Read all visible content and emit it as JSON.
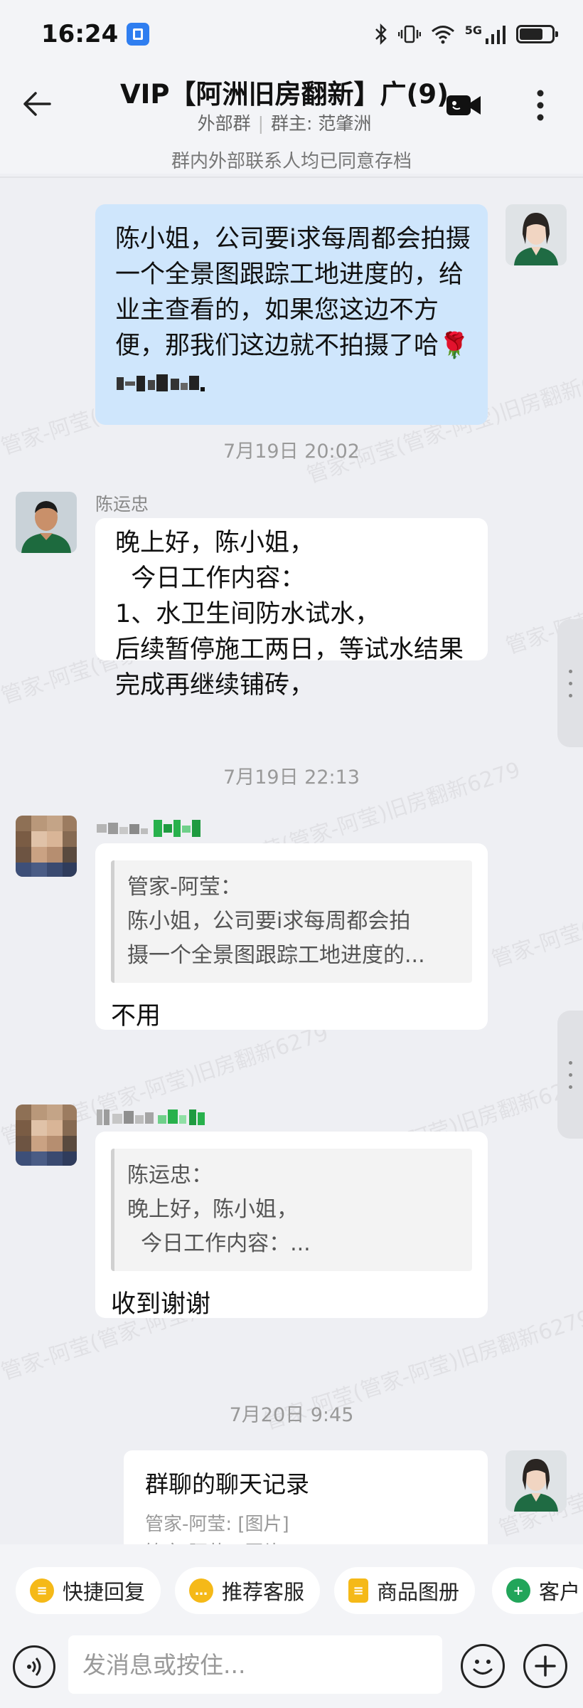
{
  "status_bar": {
    "time": "16:24",
    "network": "5G"
  },
  "header": {
    "title": "VIP【阿洲旧房翻新】广(9)",
    "group_type": "外部群",
    "owner_label": "群主: 范肇洲",
    "notice": "群内外部联系人均已同意存档"
  },
  "messages": {
    "m1": {
      "text": "陈小姐，公司要i求每周都会拍摄一个全景图跟踪工地进度的，给业主查看的，如果您这边不方便，那我们这边就不拍摄了哈🌹"
    },
    "t1": "7月19日  20:02",
    "m2": {
      "sender": "陈运忠",
      "text": "晚上好，陈小姐，\n  今日工作内容：\n1、水卫生间防水试水，\n后续暂停施工两日，等试水结果完成再继续铺砖，"
    },
    "t2": "7月19日  22:13",
    "m3": {
      "quote": "管家-阿莹：\n陈小姐，公司要i求每周都会拍\n摄一个全景图跟踪工地进度的...",
      "text": "不用"
    },
    "m4": {
      "quote": "陈运忠：\n晚上好，陈小姐，\n  今日工作内容：...",
      "text": "收到谢谢"
    },
    "t3": "7月20日  9:45",
    "m5": {
      "title": "群聊的聊天记录",
      "line1": "管家-阿莹: [图片]",
      "line2": "管家-阿莹: [图片]"
    }
  },
  "watermark": "管家-阿莹(管家-阿莹)旧房翻新6279",
  "quick_replies": [
    "快捷回复",
    "推荐客服",
    "商品图册",
    "客户"
  ],
  "input": {
    "placeholder": "发消息或按住..."
  },
  "colors": {
    "self_bubble": "#cfe6fc",
    "chip_icon": "#f5b918",
    "contact_icon": "#22a55a"
  }
}
